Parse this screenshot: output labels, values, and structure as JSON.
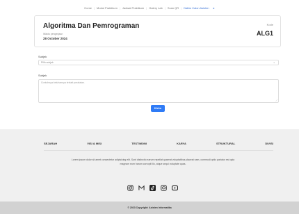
{
  "nav": {
    "items": [
      "Home",
      "Modul Praktikum",
      "Jadwal Praktikum",
      "Galery Lab",
      "Scan QR",
      "Daftar Calon Asisten"
    ]
  },
  "course": {
    "title": "Algoritma Dan Pemrograman",
    "date_label": "Waktu pengerjaan",
    "date": "28 October 2024",
    "code_label": "Kode",
    "code": "ALG1"
  },
  "form": {
    "subject_label": "Subjek",
    "subject_placeholder": "Pilih subjek",
    "message_label": "Subjek",
    "message_placeholder": "Contohnya keluhannya terkait peralatan.",
    "submit_label": "Kirim"
  },
  "footer": {
    "links": [
      "SEJARAH",
      "VISI & MISI",
      "TESTIMONI",
      "KARYA",
      "STRUKTURAL",
      "DIVISI"
    ],
    "description": "Lorem ipsum dolor sit amet consectetur adipisicing elit. Sunt distinctio earum repellat quaerat voluptatibus placeat nam, commodi optio pariatur est quia magnam eum harum corrupti illo, atque sequi voluptate quas.",
    "social_icons": [
      "instagram-icon",
      "gmail-icon",
      "tiktok-icon",
      "line-icon",
      "youtube-icon"
    ],
    "copyright": "© 2023 Copyright: Asisten Informatika"
  }
}
